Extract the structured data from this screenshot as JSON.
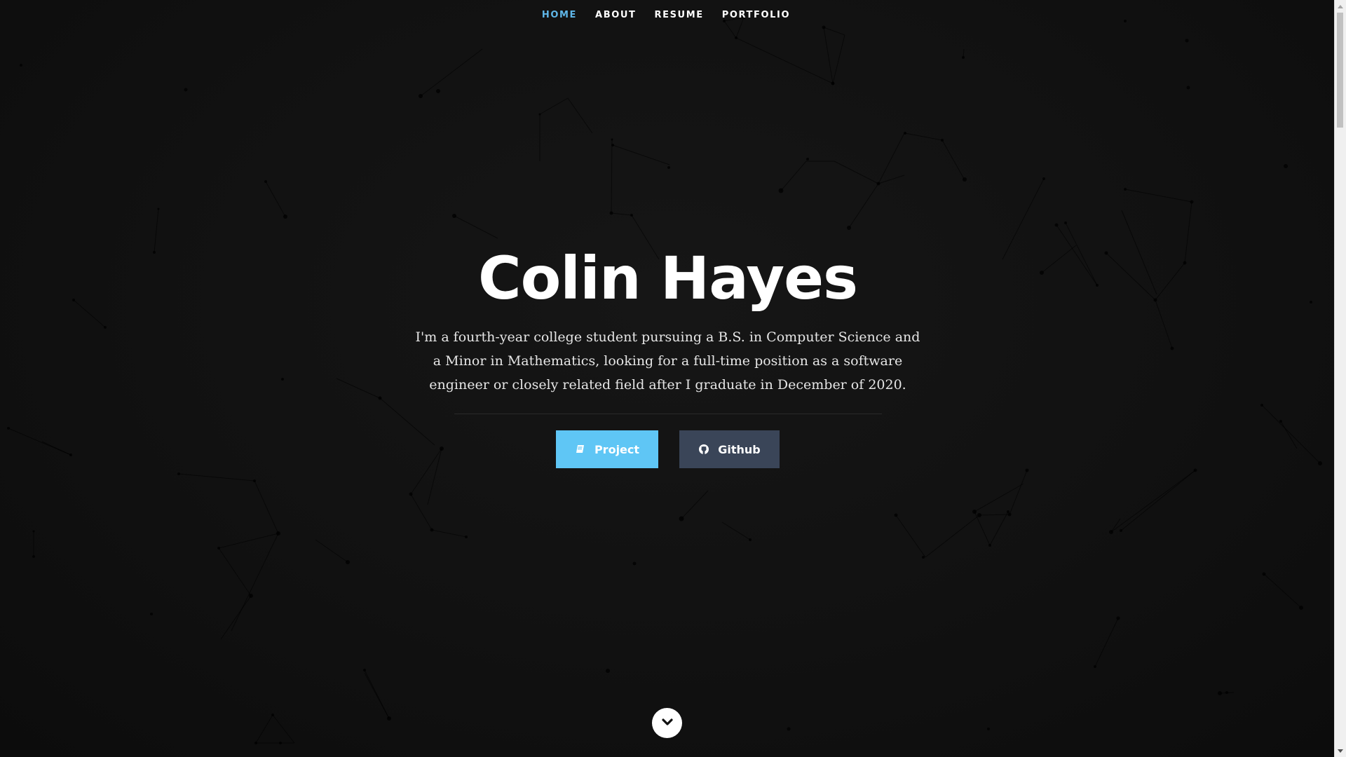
{
  "nav": {
    "items": [
      {
        "label": "HOME",
        "active": true
      },
      {
        "label": "ABOUT",
        "active": false
      },
      {
        "label": "RESUME",
        "active": false
      },
      {
        "label": "PORTFOLIO",
        "active": false
      }
    ]
  },
  "hero": {
    "name": "Colin Hayes",
    "description": "I'm a fourth-year college student pursuing a B.S. in Computer Science and a Minor in Mathematics, looking for a full-time position as a software engineer or closely related field after I graduate in December of 2020."
  },
  "buttons": {
    "project_label": "Project",
    "project_icon": "book-icon",
    "github_label": "Github",
    "github_icon": "github-icon"
  },
  "scroll_down": {
    "icon": "chevron-down-icon"
  },
  "colors": {
    "background": "#101010",
    "accent": "#5fb6e8",
    "project_button": "#5fc6f5",
    "github_button": "#3a4558"
  }
}
